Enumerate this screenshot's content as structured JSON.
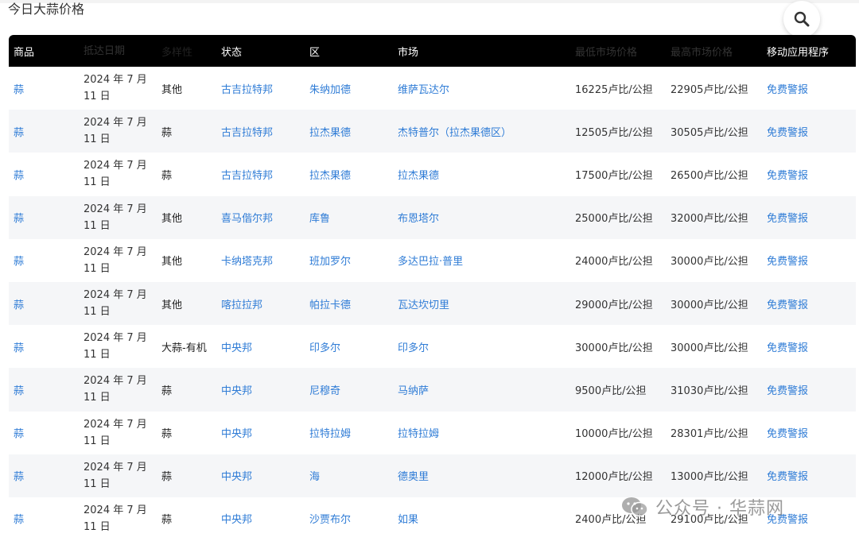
{
  "page_title": "今日大蒜价格",
  "header": {
    "columns": [
      "商品",
      "抵达日期",
      "多样性",
      "状态",
      "区",
      "市场",
      "最低市场价格",
      "最高市场价格",
      "移动应用程序"
    ]
  },
  "rows": [
    {
      "commodity": "蒜",
      "date_line1": "2024 年 7 月",
      "date_line2": "11 日",
      "variety": "其他",
      "state": "古吉拉特邦",
      "district": "朱纳加德",
      "market": "维萨瓦达尔",
      "min_price": "16225卢比/公担",
      "max_price": "22905卢比/公担",
      "app": "免费警报"
    },
    {
      "commodity": "蒜",
      "date_line1": "2024 年 7 月",
      "date_line2": "11 日",
      "variety": "蒜",
      "state": "古吉拉特邦",
      "district": "拉杰果德",
      "market": "杰特普尔（拉杰果德区）",
      "min_price": "12505卢比/公担",
      "max_price": "30505卢比/公担",
      "app": "免费警报"
    },
    {
      "commodity": "蒜",
      "date_line1": "2024 年 7 月",
      "date_line2": "11 日",
      "variety": "蒜",
      "state": "古吉拉特邦",
      "district": "拉杰果德",
      "market": "拉杰果德",
      "min_price": "17500卢比/公担",
      "max_price": "26500卢比/公担",
      "app": "免费警报"
    },
    {
      "commodity": "蒜",
      "date_line1": "2024 年 7 月",
      "date_line2": "11 日",
      "variety": "其他",
      "state": "喜马偕尔邦",
      "district": "库鲁",
      "market": "布恩塔尔",
      "min_price": "25000卢比/公担",
      "max_price": "32000卢比/公担",
      "app": "免费警报"
    },
    {
      "commodity": "蒜",
      "date_line1": "2024 年 7 月",
      "date_line2": "11 日",
      "variety": "其他",
      "state": "卡纳塔克邦",
      "district": "班加罗尔",
      "market": "多达巴拉·普里",
      "min_price": "24000卢比/公担",
      "max_price": "30000卢比/公担",
      "app": "免费警报"
    },
    {
      "commodity": "蒜",
      "date_line1": "2024 年 7 月",
      "date_line2": "11 日",
      "variety": "其他",
      "state": "喀拉拉邦",
      "district": "帕拉卡德",
      "market": "瓦达坎切里",
      "min_price": "29000卢比/公担",
      "max_price": "30000卢比/公担",
      "app": "免费警报"
    },
    {
      "commodity": "蒜",
      "date_line1": "2024 年 7 月",
      "date_line2": "11 日",
      "variety": "大蒜-有机",
      "state": "中央邦",
      "district": "印多尔",
      "market": "印多尔",
      "min_price": "30000卢比/公担",
      "max_price": "30000卢比/公担",
      "app": "免费警报"
    },
    {
      "commodity": "蒜",
      "date_line1": "2024 年 7 月",
      "date_line2": "11 日",
      "variety": "蒜",
      "state": "中央邦",
      "district": "尼穆奇",
      "market": "马纳萨",
      "min_price": "9500卢比/公担",
      "max_price": "31030卢比/公担",
      "app": "免费警报"
    },
    {
      "commodity": "蒜",
      "date_line1": "2024 年 7 月",
      "date_line2": "11 日",
      "variety": "蒜",
      "state": "中央邦",
      "district": "拉特拉姆",
      "market": "拉特拉姆",
      "min_price": "10000卢比/公担",
      "max_price": "28301卢比/公担",
      "app": "免费警报"
    },
    {
      "commodity": "蒜",
      "date_line1": "2024 年 7 月",
      "date_line2": "11 日",
      "variety": "蒜",
      "state": "中央邦",
      "district": "海",
      "market": "德奥里",
      "min_price": "12000卢比/公担",
      "max_price": "13000卢比/公担",
      "app": "免费警报"
    },
    {
      "commodity": "蒜",
      "date_line1": "2024 年 7 月",
      "date_line2": "11 日",
      "variety": "蒜",
      "state": "中央邦",
      "district": "沙贾布尔",
      "market": "如果",
      "min_price": "2400卢比/公担",
      "max_price": "29100卢比/公担",
      "app": "免费警报"
    }
  ],
  "watermark": "公众号 · 华蒜网",
  "colors": {
    "link": "#2f7cd6",
    "header_bg": "#000000",
    "stripe": "#f5f6f8"
  },
  "icons": {
    "search": "search-icon",
    "watermark": "wechat-icon"
  }
}
